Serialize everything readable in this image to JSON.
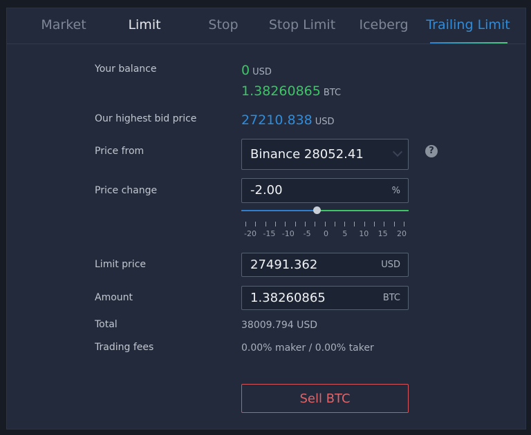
{
  "tabs": [
    {
      "label": "Market"
    },
    {
      "label": "Limit"
    },
    {
      "label": "Stop"
    },
    {
      "label": "Stop Limit"
    },
    {
      "label": "Iceberg"
    },
    {
      "label": "Trailing Limit"
    }
  ],
  "balance": {
    "label": "Your balance",
    "usd_value": "0",
    "usd_unit": "USD",
    "btc_value": "1.38260865",
    "btc_unit": "BTC"
  },
  "highest_bid": {
    "label": "Our highest bid price",
    "value": "27210.838",
    "unit": "USD"
  },
  "price_from": {
    "label": "Price from",
    "selected": "Binance 28052.41",
    "help_icon": "question-mark-icon"
  },
  "price_change": {
    "label": "Price change",
    "value": "-2.00",
    "unit": "%",
    "slider_value": -2,
    "slider_min": -20,
    "slider_max": 20,
    "tick_labels": [
      "-20",
      "-15",
      "-10",
      "-5",
      "0",
      "5",
      "10",
      "15",
      "20"
    ]
  },
  "limit_price": {
    "label": "Limit price",
    "value": "27491.362",
    "unit": "USD"
  },
  "amount": {
    "label": "Amount",
    "value": "1.38260865",
    "unit": "BTC"
  },
  "total": {
    "label": "Total",
    "value": "38009.794 USD"
  },
  "fees": {
    "label": "Trading fees",
    "value": "0.00% maker / 0.00% taker"
  },
  "sell_button": {
    "label": "Sell BTC"
  },
  "colors": {
    "background": "#222a3b",
    "accent_blue": "#2e8ddd",
    "positive_green": "#3ec566",
    "sell_red": "#e0656a"
  }
}
